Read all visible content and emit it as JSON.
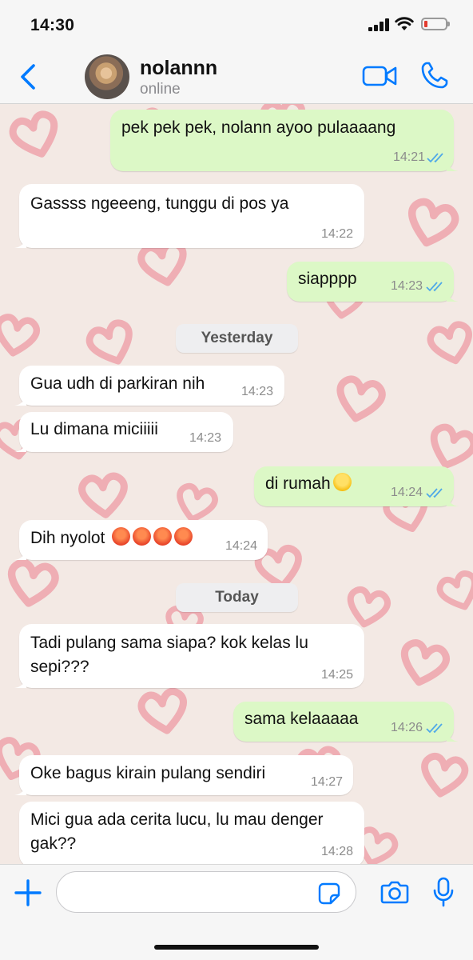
{
  "status_bar": {
    "time": "14:30"
  },
  "header": {
    "name": "nolannn",
    "status": "online"
  },
  "date_labels": {
    "yesterday": "Yesterday",
    "today": "Today"
  },
  "messages": [
    {
      "dir": "out",
      "text": "pek pek pek, nolann ayoo pulaaaang",
      "time": "14:21",
      "read": true
    },
    {
      "dir": "in",
      "text": "Gassss ngeeeng, tunggu di pos ya",
      "time": "14:22"
    },
    {
      "dir": "out",
      "text": "siapppp",
      "time": "14:23",
      "read": true
    },
    {
      "dir": "in",
      "text": "Gua udh di parkiran nih",
      "time": "14:23"
    },
    {
      "dir": "in",
      "text": "Lu dimana miciiiii",
      "time": "14:23"
    },
    {
      "dir": "out",
      "text": "di rumah",
      "time": "14:24",
      "read": true,
      "emoji": "zany-face"
    },
    {
      "dir": "in",
      "text": "Dih nyolot",
      "time": "14:24",
      "emoji": "angry-face x4"
    },
    {
      "dir": "in",
      "text": "Tadi pulang sama siapa? kok kelas lu sepi???",
      "time": "14:25"
    },
    {
      "dir": "out",
      "text": "sama kelaaaaa",
      "time": "14:26",
      "read": true
    },
    {
      "dir": "in",
      "text": "Oke bagus kirain pulang sendiri",
      "time": "14:27"
    },
    {
      "dir": "in",
      "text": "Mici gua ada cerita lucu, lu mau denger gak??",
      "time": "14:28"
    }
  ],
  "input": {
    "value": "",
    "placeholder": ""
  },
  "colors": {
    "accent": "#007aff",
    "outgoing_bubble": "#dcf8c6",
    "incoming_bubble": "#ffffff",
    "chat_background": "#f3e9e4",
    "heart_pattern": "#ee9aa4",
    "read_ticks": "#4fa8e8"
  }
}
